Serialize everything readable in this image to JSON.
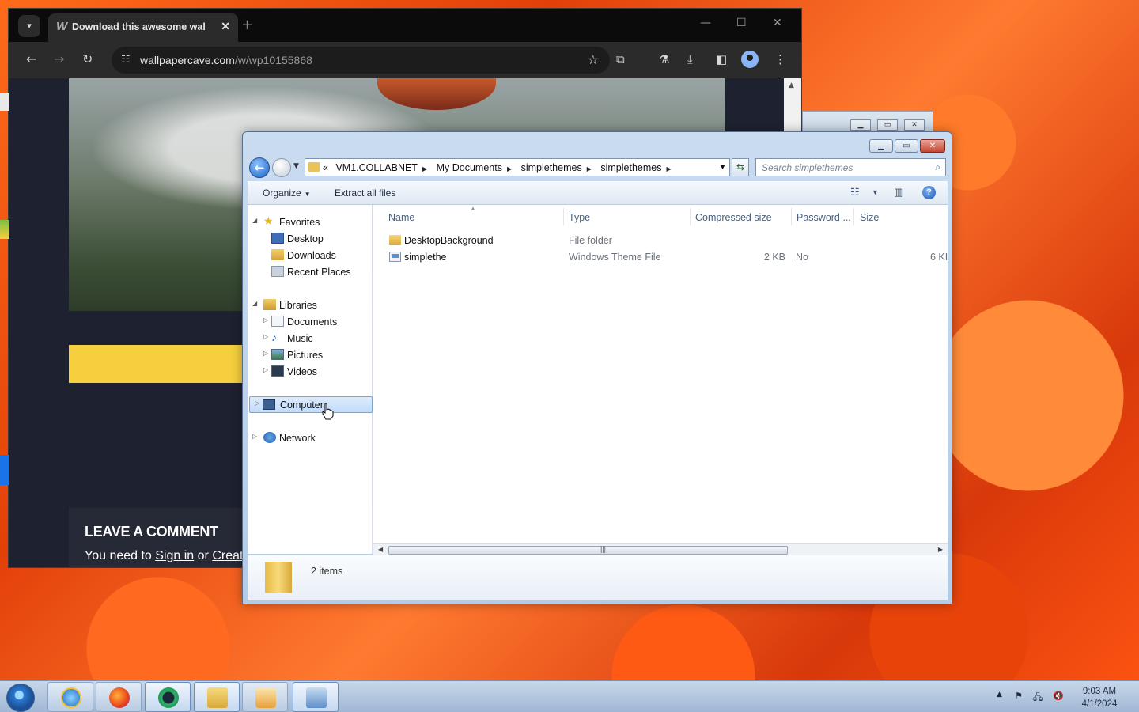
{
  "browser": {
    "tab_title": "Download this awesome wallp",
    "tab_close": "✕",
    "new_tab": "+",
    "url_host": "wallpapercave.com",
    "url_path": "/w/wp10155868",
    "page": {
      "comment_title": "LEAVE A COMMENT",
      "comment_prefix": "You need to ",
      "comment_sign_in": "Sign in",
      "comment_mid": " or ",
      "comment_create": "Creat"
    },
    "colors": {
      "banner": "#f5cf3d",
      "page_bg": "#1e2230"
    }
  },
  "explorer": {
    "breadcrumb": [
      "VM1.COLLABNET",
      "My Documents",
      "simplethemes",
      "simplethemes"
    ],
    "breadcrumb_prefix": "«",
    "search_placeholder": "Search simplethemes",
    "commands": {
      "organize": "Organize",
      "extract": "Extract all files"
    },
    "nav": {
      "favorites": "Favorites",
      "desktop": "Desktop",
      "downloads": "Downloads",
      "recent": "Recent Places",
      "libraries": "Libraries",
      "documents": "Documents",
      "music": "Music",
      "pictures": "Pictures",
      "videos": "Videos",
      "computer": "Computer",
      "network": "Network"
    },
    "columns": {
      "name": "Name",
      "type": "Type",
      "compressed": "Compressed size",
      "password": "Password ...",
      "size": "Size"
    },
    "files": [
      {
        "name": "DesktopBackground",
        "type": "File folder",
        "compressed": "",
        "password": "",
        "size": ""
      },
      {
        "name": "simplethe",
        "type": "Windows Theme File",
        "compressed": "2 KB",
        "password": "No",
        "size": "6 KI"
      }
    ],
    "status": "2 items"
  },
  "taskbar": {
    "time": "9:03 AM",
    "date": "4/1/2024"
  }
}
